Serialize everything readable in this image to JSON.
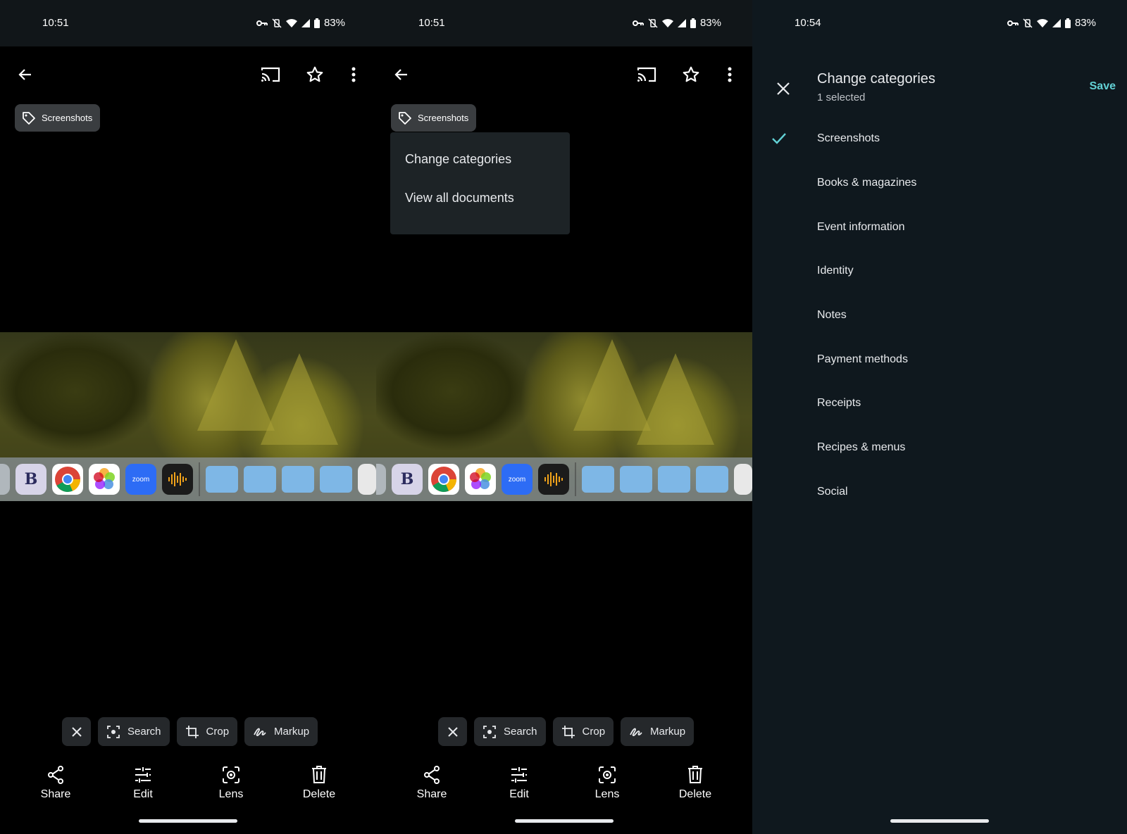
{
  "panels": [
    {
      "status": {
        "time": "10:51",
        "battery": "83%"
      },
      "chip_label": "Screenshots",
      "actions": {
        "search": "Search",
        "crop": "Crop",
        "markup": "Markup"
      },
      "bottom": {
        "share": "Share",
        "edit": "Edit",
        "lens": "Lens",
        "delete": "Delete"
      }
    },
    {
      "status": {
        "time": "10:51",
        "battery": "83%"
      },
      "chip_label": "Screenshots",
      "menu": [
        "Change categories",
        "View all documents"
      ],
      "actions": {
        "search": "Search",
        "crop": "Crop",
        "markup": "Markup"
      },
      "bottom": {
        "share": "Share",
        "edit": "Edit",
        "lens": "Lens",
        "delete": "Delete"
      }
    },
    {
      "status": {
        "time": "10:54",
        "battery": "83%"
      },
      "title": "Change categories",
      "subtitle": "1 selected",
      "save_label": "Save",
      "categories": [
        {
          "label": "Screenshots",
          "checked": true
        },
        {
          "label": "Books & magazines",
          "checked": false
        },
        {
          "label": "Event information",
          "checked": false
        },
        {
          "label": "Identity",
          "checked": false
        },
        {
          "label": "Notes",
          "checked": false
        },
        {
          "label": "Payment methods",
          "checked": false
        },
        {
          "label": "Receipts",
          "checked": false
        },
        {
          "label": "Recipes & menus",
          "checked": false
        },
        {
          "label": "Social",
          "checked": false
        }
      ]
    }
  ],
  "dock_apps": [
    "compass",
    "b",
    "chrome",
    "photos",
    "zoom",
    "audio",
    "home-folder",
    "apps-folder",
    "documents-folder",
    "downloads-folder",
    "trash"
  ],
  "zoom_text": "zoom",
  "colors": {
    "accent": "#62d1d5",
    "panel3_bg": "#0f181e",
    "chip_bg": "#3a3d40",
    "menu_bg": "#1d2326"
  }
}
